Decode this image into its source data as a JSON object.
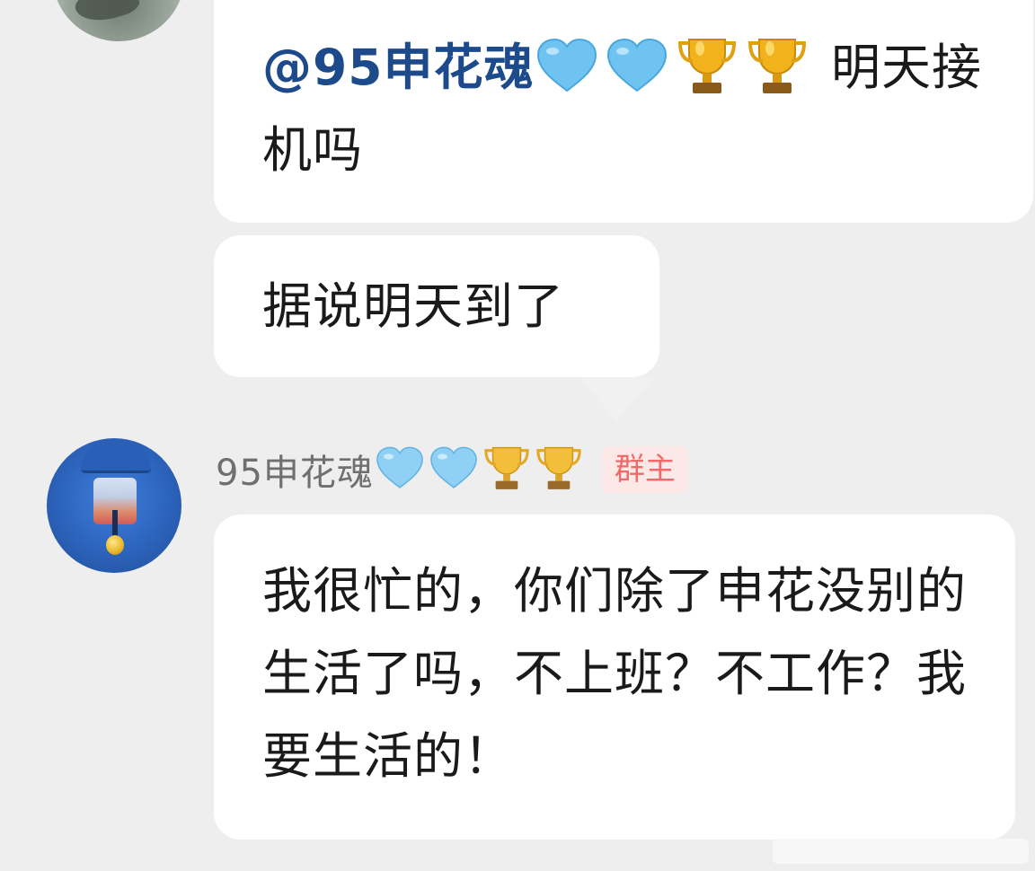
{
  "messages": [
    {
      "mention": "@95申花魂",
      "mention_icons": [
        "blue-heart-icon",
        "blue-heart-icon",
        "trophy-icon",
        "trophy-icon"
      ],
      "text": "明天接机吗"
    },
    {
      "text": "据说明天到了"
    },
    {
      "sender": {
        "name": "95申花魂",
        "icons": [
          "blue-heart-icon",
          "blue-heart-icon",
          "trophy-icon",
          "trophy-icon"
        ],
        "role": "群主"
      },
      "text": "我很忙的，你们除了申花没别的生活了吗，不上班？不工作？我要生活的！"
    }
  ],
  "colors": {
    "background": "#eeeeee",
    "bubble": "#ffffff",
    "mention": "#1d4a8a",
    "role_badge_text": "#ee6b6b",
    "role_badge_bg": "#fde8e8",
    "sender_name": "#6f6f6f"
  }
}
